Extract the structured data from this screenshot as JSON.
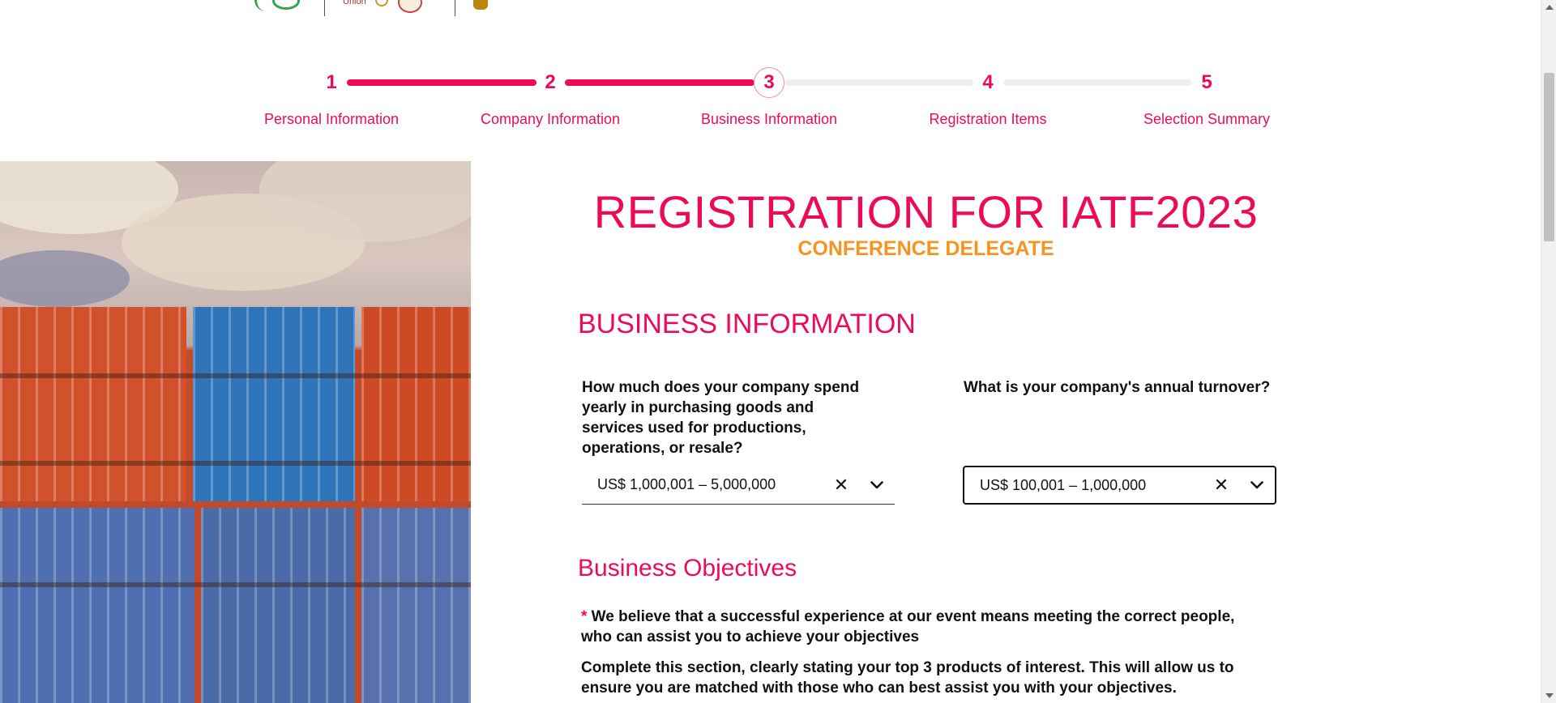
{
  "header": {
    "logo_text": "Union"
  },
  "stepper": {
    "steps": [
      {
        "number": "1",
        "label": "Personal Information",
        "status": "completed"
      },
      {
        "number": "2",
        "label": "Company Information",
        "status": "completed"
      },
      {
        "number": "3",
        "label": "Business Information",
        "status": "current"
      },
      {
        "number": "4",
        "label": "Registration Items",
        "status": "upcoming"
      },
      {
        "number": "5",
        "label": "Selection Summary",
        "status": "upcoming"
      }
    ]
  },
  "form": {
    "title": "REGISTRATION FOR IATF2023",
    "subtitle": "CONFERENCE DELEGATE",
    "section_title": "BUSINESS INFORMATION",
    "question_spend": "How much does your company spend yearly in purchasing goods and services used for productions, operations, or resale?",
    "spend_value": "US$ 1,000,001 – 5,000,000",
    "question_turnover": "What is your company's annual turnover?",
    "turnover_value": "US$ 100,001 – 1,000,000",
    "clear_glyph": "✕",
    "objectives_title": "Business Objectives",
    "required_marker": "*",
    "objectives_text_1": " We believe that a successful experience at our event means meeting the correct people, who can assist you to achieve your objectives",
    "objectives_text_2": "Complete this section, clearly stating your top 3 products of interest. This will allow us to ensure you are matched with those who can best assist you with your objectives."
  },
  "colors": {
    "accent": "#ee0b55",
    "secondary": "#f7931e",
    "track_inactive": "#efefef"
  },
  "icons": {
    "clear": "close-icon",
    "dropdown": "chevron-down-icon"
  }
}
